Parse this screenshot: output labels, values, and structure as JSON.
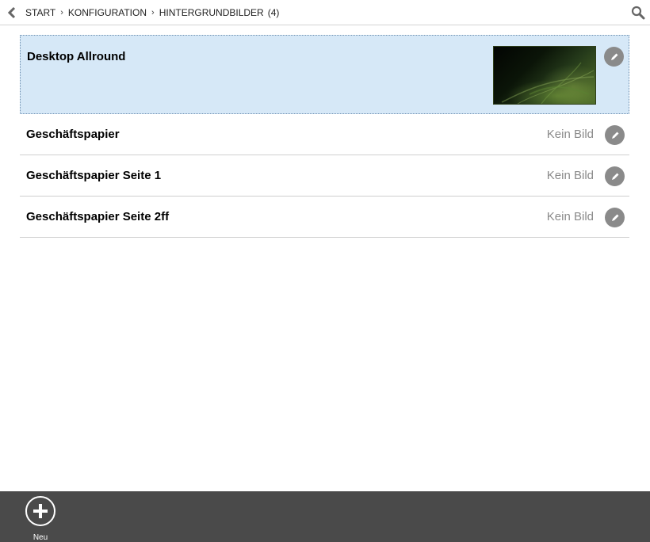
{
  "header": {
    "breadcrumb": [
      {
        "label": "START"
      },
      {
        "label": "KONFIGURATION"
      },
      {
        "label": "HINTERGRUNDBILDER"
      }
    ],
    "count": "(4)",
    "back_icon": "chevron-left-icon",
    "search_icon": "search-icon"
  },
  "list": {
    "items": [
      {
        "title": "Desktop Allround",
        "status": "",
        "selected": true,
        "has_image": true
      },
      {
        "title": "Geschäftspapier",
        "status": "Kein Bild",
        "selected": false,
        "has_image": false
      },
      {
        "title": "Geschäftspapier Seite 1",
        "status": "Kein Bild",
        "selected": false,
        "has_image": false
      },
      {
        "title": "Geschäftspapier Seite 2ff",
        "status": "Kein Bild",
        "selected": false,
        "has_image": false
      }
    ],
    "edit_icon": "pencil-icon"
  },
  "appbar": {
    "new_label": "Neu",
    "new_icon": "plus-icon"
  },
  "colors": {
    "selected_bg": "#d6e8f7",
    "appbar_bg": "#4a4a4a",
    "edit_icon_bg": "#8a8a8a",
    "status_text": "#8a8a8a"
  }
}
